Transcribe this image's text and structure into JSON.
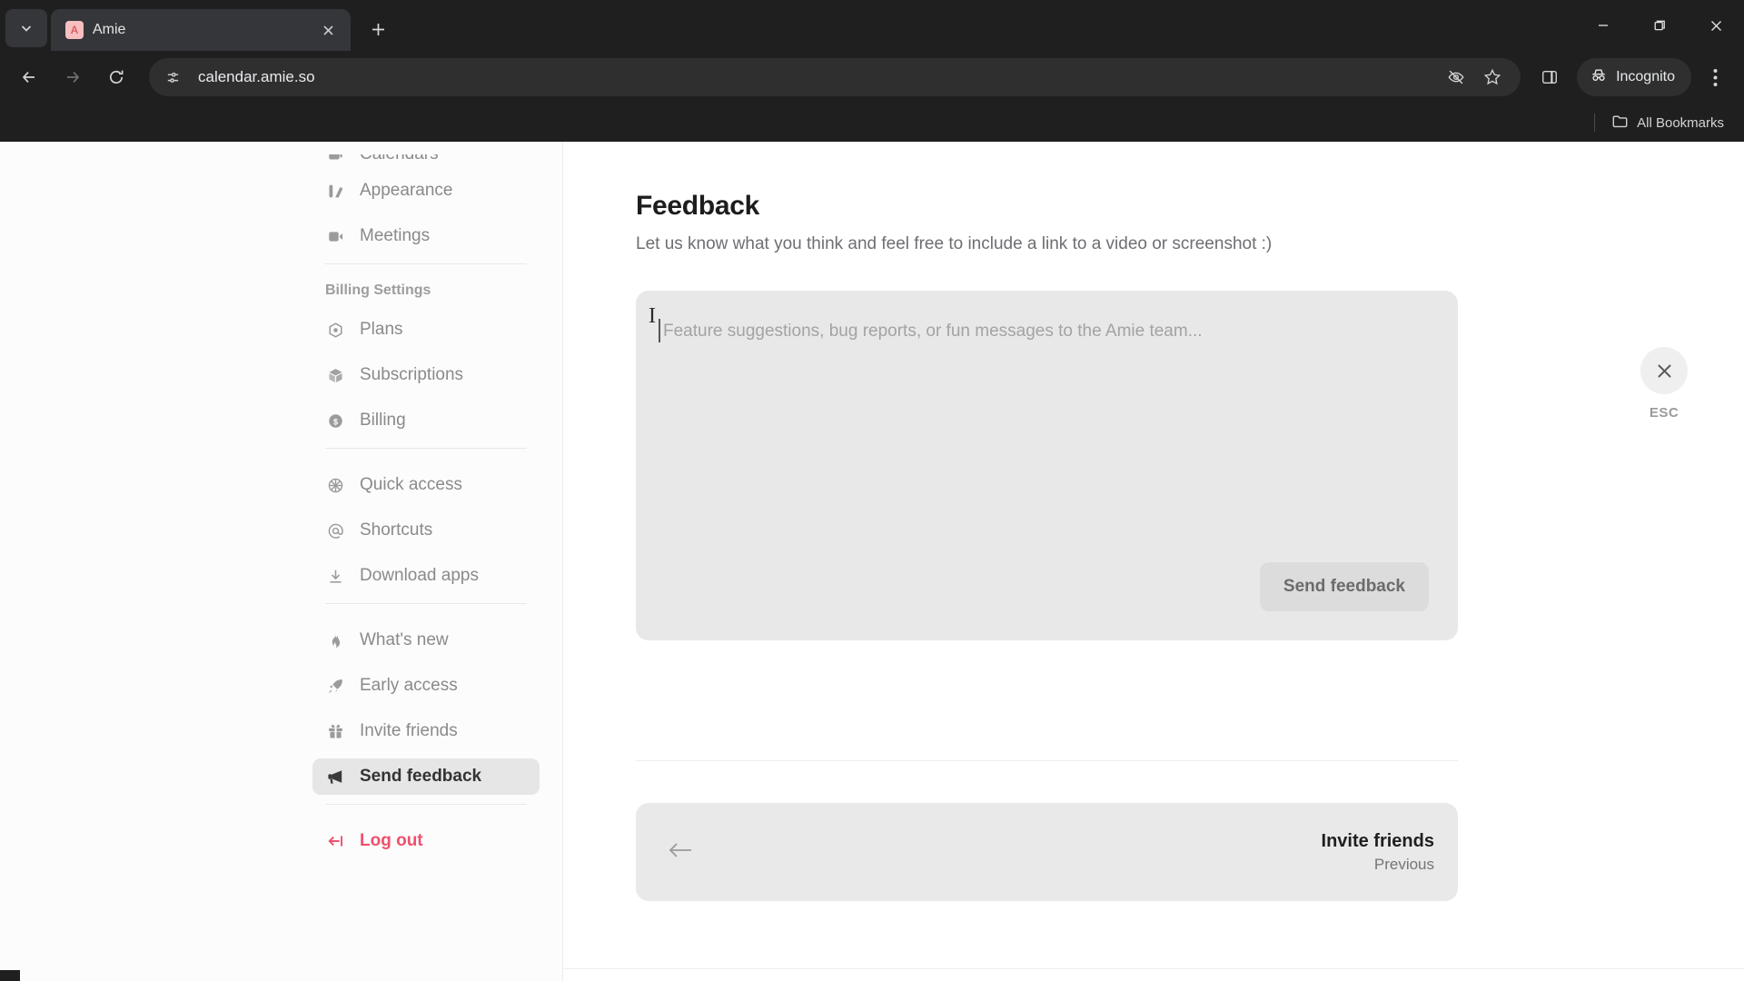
{
  "browser": {
    "tab": {
      "title": "Amie",
      "favicon_letter": "A",
      "favicon_color": "#f8bfc0"
    },
    "tab_list_icon": "chevron-down-icon",
    "new_tab_label": "+",
    "window_controls": {
      "minimize": "–",
      "maximize": "❐",
      "close": "✕"
    },
    "toolbar": {
      "back": "←",
      "forward": "→",
      "reload": "⟳",
      "site_info_icon": "page-settings-icon",
      "url": "calendar.amie.so",
      "tracking_protection_icon": "eye-off-icon",
      "bookmark_icon": "star-icon",
      "side_panel_icon": "side-panel-icon",
      "profile_label": "Incognito",
      "menu_icon": "three-dot-menu-icon"
    },
    "bookmarks_bar": {
      "label": "All Bookmarks",
      "icon": "folder-icon"
    }
  },
  "sidebar": {
    "clipped_top_item": {
      "label": "Calendars",
      "icon": "calendar-icon"
    },
    "groups": [
      {
        "label": "",
        "items": [
          {
            "label": "Appearance",
            "icon": "appearance-icon"
          },
          {
            "label": "Meetings",
            "icon": "video-icon"
          }
        ]
      },
      {
        "label": "Billing Settings",
        "items": [
          {
            "label": "Plans",
            "icon": "hexagon-icon"
          },
          {
            "label": "Subscriptions",
            "icon": "cube-icon"
          },
          {
            "label": "Billing",
            "icon": "dollar-circle-icon"
          }
        ]
      },
      {
        "label": "",
        "items": [
          {
            "label": "Quick access",
            "icon": "wheel-icon"
          },
          {
            "label": "Shortcuts",
            "icon": "at-sign-icon"
          },
          {
            "label": "Download apps",
            "icon": "download-icon"
          }
        ]
      },
      {
        "label": "",
        "items": [
          {
            "label": "What's new",
            "icon": "flame-icon"
          },
          {
            "label": "Early access",
            "icon": "rocket-icon"
          },
          {
            "label": "Invite friends",
            "icon": "gift-icon"
          },
          {
            "label": "Send feedback",
            "icon": "megaphone-icon",
            "active": true
          }
        ]
      }
    ],
    "logout": {
      "label": "Log out",
      "icon": "logout-icon",
      "color": "#f0506e"
    }
  },
  "main": {
    "title": "Feedback",
    "subtitle": "Let us know what you think and feel free to include a link to a video or screenshot :)",
    "compose": {
      "placeholder": "Feature suggestions, bug reports, or fun messages to the Amie team...",
      "value": "",
      "send_label": "Send feedback"
    },
    "close": {
      "icon": "close-icon",
      "label": "ESC"
    },
    "prev_nav": {
      "arrow_icon": "arrow-left-icon",
      "title": "Invite friends",
      "caption": "Previous"
    }
  }
}
